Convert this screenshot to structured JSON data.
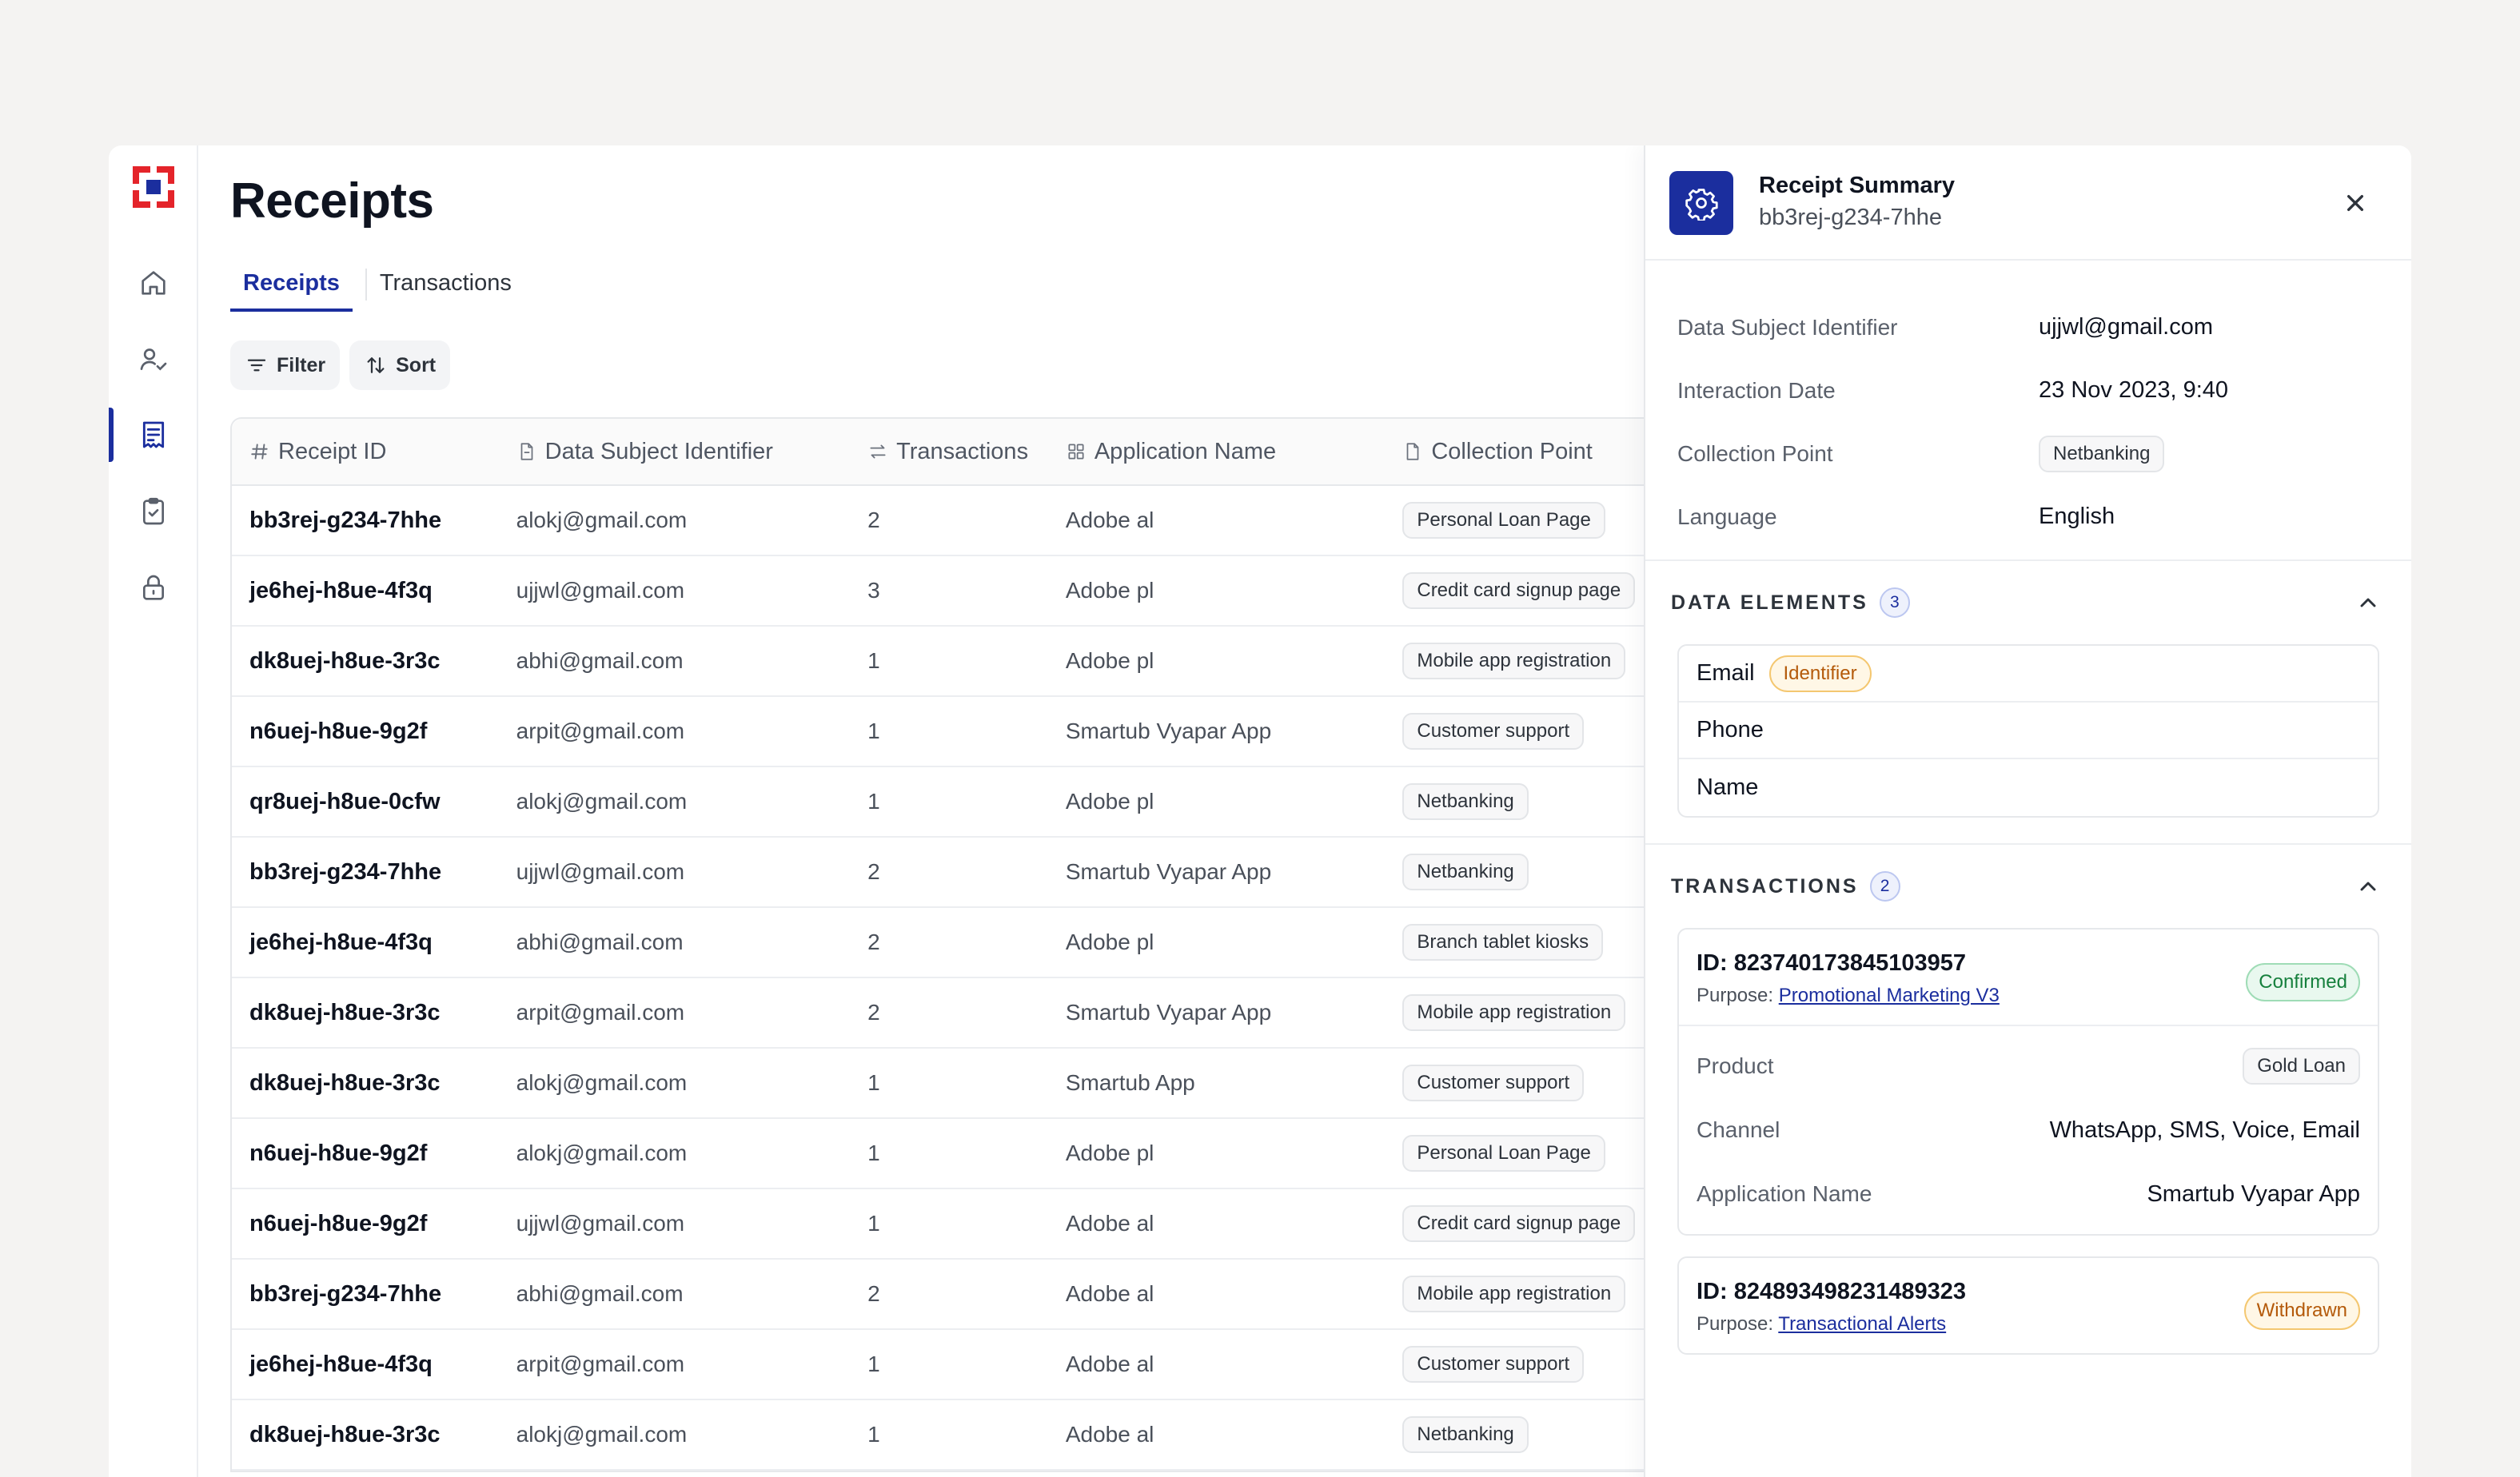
{
  "page": {
    "title": "Receipts",
    "tabs": [
      {
        "label": "Receipts",
        "active": true
      },
      {
        "label": "Transactions",
        "active": false
      }
    ],
    "toolbar": {
      "filter_label": "Filter",
      "sort_label": "Sort"
    }
  },
  "sidebar": {
    "brand_color": "#e4242a",
    "accent_color": "#1b2e9e",
    "items": [
      {
        "icon": "home-icon",
        "active": false
      },
      {
        "icon": "user-check-icon",
        "active": false
      },
      {
        "icon": "receipt-icon",
        "active": true
      },
      {
        "icon": "clipboard-check-icon",
        "active": false
      },
      {
        "icon": "lock-icon",
        "active": false
      }
    ]
  },
  "table": {
    "columns": [
      "Receipt ID",
      "Data Subject Identifier",
      "Transactions",
      "Application Name",
      "Collection Point"
    ],
    "rows": [
      [
        "bb3rej-g234-7hhe",
        "alokj@gmail.com",
        "2",
        "Adobe al",
        "Personal Loan Page"
      ],
      [
        "je6hej-h8ue-4f3q",
        "ujjwl@gmail.com",
        "3",
        "Adobe pl",
        "Credit card signup page"
      ],
      [
        "dk8uej-h8ue-3r3c",
        "abhi@gmail.com",
        "1",
        "Adobe pl",
        "Mobile app registration"
      ],
      [
        "n6uej-h8ue-9g2f",
        "arpit@gmail.com",
        "1",
        "Smartub Vyapar App",
        "Customer support"
      ],
      [
        "qr8uej-h8ue-0cfw",
        "alokj@gmail.com",
        "1",
        "Adobe pl",
        "Netbanking"
      ],
      [
        "bb3rej-g234-7hhe",
        "ujjwl@gmail.com",
        "2",
        "Smartub Vyapar App",
        "Netbanking"
      ],
      [
        "je6hej-h8ue-4f3q",
        "abhi@gmail.com",
        "2",
        "Adobe pl",
        "Branch tablet kiosks"
      ],
      [
        "dk8uej-h8ue-3r3c",
        "arpit@gmail.com",
        "2",
        "Smartub Vyapar App",
        "Mobile app registration"
      ],
      [
        "dk8uej-h8ue-3r3c",
        "alokj@gmail.com",
        "1",
        "Smartub App",
        "Customer support"
      ],
      [
        "n6uej-h8ue-9g2f",
        "alokj@gmail.com",
        "1",
        "Adobe pl",
        "Personal Loan Page"
      ],
      [
        "n6uej-h8ue-9g2f",
        "ujjwl@gmail.com",
        "1",
        "Adobe al",
        "Credit card signup page"
      ],
      [
        "bb3rej-g234-7hhe",
        "abhi@gmail.com",
        "2",
        "Adobe al",
        "Mobile app registration"
      ],
      [
        "je6hej-h8ue-4f3q",
        "arpit@gmail.com",
        "1",
        "Adobe al",
        "Customer support"
      ],
      [
        "dk8uej-h8ue-3r3c",
        "alokj@gmail.com",
        "1",
        "Adobe al",
        "Netbanking"
      ]
    ]
  },
  "panel": {
    "title": "Receipt Summary",
    "subtitle": "bb3rej-g234-7hhe",
    "details": [
      {
        "label": "Data Subject Identifier",
        "value": "ujjwl@gmail.com",
        "chip": false
      },
      {
        "label": "Interaction Date",
        "value": "23 Nov 2023, 9:40",
        "chip": false
      },
      {
        "label": "Collection Point",
        "value": "Netbanking",
        "chip": true
      },
      {
        "label": "Language",
        "value": "English",
        "chip": false
      }
    ],
    "data_elements": {
      "title": "DATA ELEMENTS",
      "count": "3",
      "items": [
        {
          "name": "Email",
          "tag": "Identifier"
        },
        {
          "name": "Phone",
          "tag": ""
        },
        {
          "name": "Name",
          "tag": ""
        }
      ]
    },
    "transactions": {
      "title": "TRANSACTIONS",
      "count": "2",
      "items": [
        {
          "id": "ID: 823740173845103957",
          "purpose_label": "Purpose:",
          "purpose": "Promotional Marketing V3",
          "status": "Confirmed",
          "fields": [
            {
              "label": "Product",
              "value": "Gold Loan",
              "chip": true
            },
            {
              "label": "Channel",
              "value": "WhatsApp, SMS, Voice, Email",
              "chip": false
            },
            {
              "label": "Application Name",
              "value": "Smartub Vyapar App",
              "chip": false
            }
          ]
        },
        {
          "id": "ID: 824893498231489323",
          "purpose_label": "Purpose:",
          "purpose": "Transactional Alerts",
          "status": "Withdrawn",
          "fields": []
        }
      ]
    }
  }
}
